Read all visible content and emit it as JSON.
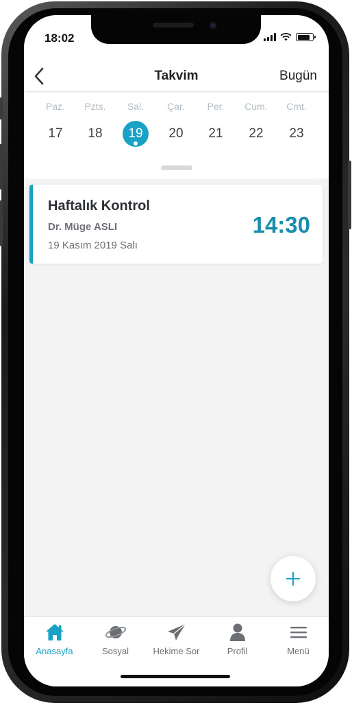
{
  "status": {
    "time": "18:02",
    "battery_level": 0.85
  },
  "header": {
    "title": "Takvim",
    "today_label": "Bugün",
    "back_icon": "chevron-left-icon"
  },
  "week": {
    "days": [
      {
        "name": "Paz.",
        "num": "17"
      },
      {
        "name": "Pzts.",
        "num": "18"
      },
      {
        "name": "Sal.",
        "num": "19"
      },
      {
        "name": "Çar.",
        "num": "20"
      },
      {
        "name": "Per.",
        "num": "21"
      },
      {
        "name": "Cum.",
        "num": "22"
      },
      {
        "name": "Cmt.",
        "num": "23"
      }
    ],
    "selected_day": "19"
  },
  "appointment": {
    "title": "Haftalık Kontrol",
    "doctor": "Dr. Müge ASLI",
    "date": "19 Kasım 2019 Salı",
    "time": "14:30"
  },
  "fab": {
    "icon": "plus-icon"
  },
  "tabs": [
    {
      "label": "Anasayfa",
      "icon": "home-icon",
      "active": true
    },
    {
      "label": "Sosyal",
      "icon": "planet-icon",
      "active": false
    },
    {
      "label": "Hekime Sor",
      "icon": "paper-plane-icon",
      "active": false
    },
    {
      "label": "Profil",
      "icon": "person-icon",
      "active": false
    },
    {
      "label": "Menü",
      "icon": "hamburger-menu-icon",
      "active": false
    }
  ],
  "colors": {
    "accent": "#1aa2c6",
    "time_text": "#1a8fad",
    "inactive_tab": "#6b6f74"
  }
}
